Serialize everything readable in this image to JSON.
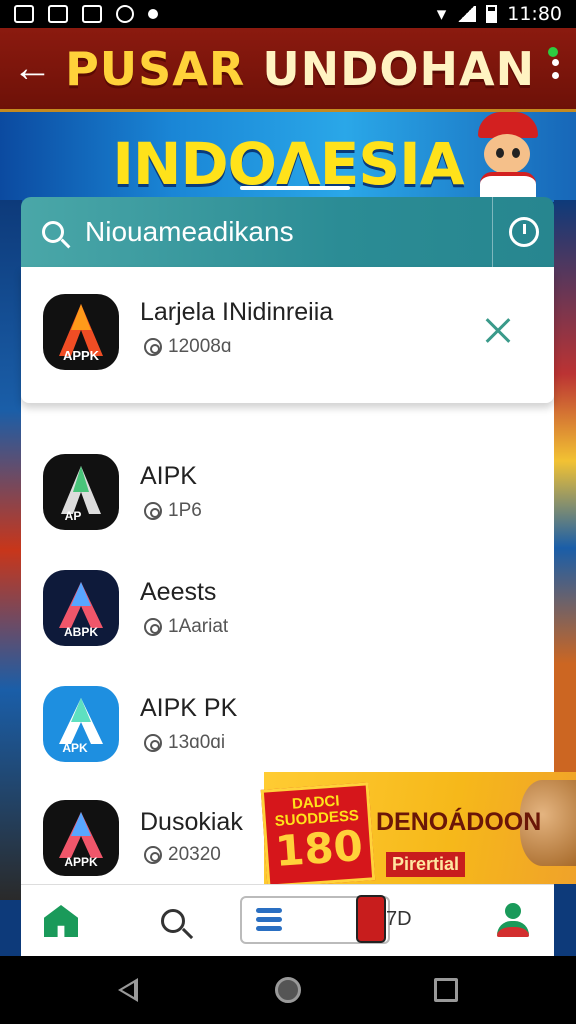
{
  "status_bar": {
    "time": "11:80"
  },
  "header": {
    "title_part1": "PUSAR",
    "title_part2": "UNDOHAN"
  },
  "banner": {
    "title": "INDOΛESIA"
  },
  "search": {
    "placeholder": "Niouameadikans"
  },
  "featured": {
    "name": "Larjela INidinreiia",
    "meta": "12008ɑ",
    "icon_label": "APPK"
  },
  "apps": [
    {
      "name": "AIPK",
      "meta": "1Ρ6",
      "icon_label": "AP"
    },
    {
      "name": "Aeests",
      "meta": "1Aariat",
      "icon_label": "AΒPK"
    },
    {
      "name": "AIPK PK",
      "meta": "13ɑ0ɑi",
      "icon_label": "APK"
    },
    {
      "name": "Dusokiak",
      "meta": "20320",
      "icon_label": "AΡPK"
    }
  ],
  "promo": {
    "badge_top": "DADCI SUODDESS",
    "badge_number": "180",
    "title": "DENOÁDOON",
    "subtitle": "Pirertial"
  },
  "bottom_nav": {
    "promo_label": "7D"
  },
  "colors": {
    "header": "#8b1a0f",
    "accent_teal": "#2b8c95",
    "nav_green": "#1a9a5a",
    "banner_yellow": "#ffe21a"
  },
  "icons": [
    "back-arrow-icon",
    "overflow-menu-icon",
    "search-icon",
    "timer-icon",
    "close-icon",
    "downloads-icon",
    "home-icon",
    "user-icon"
  ]
}
